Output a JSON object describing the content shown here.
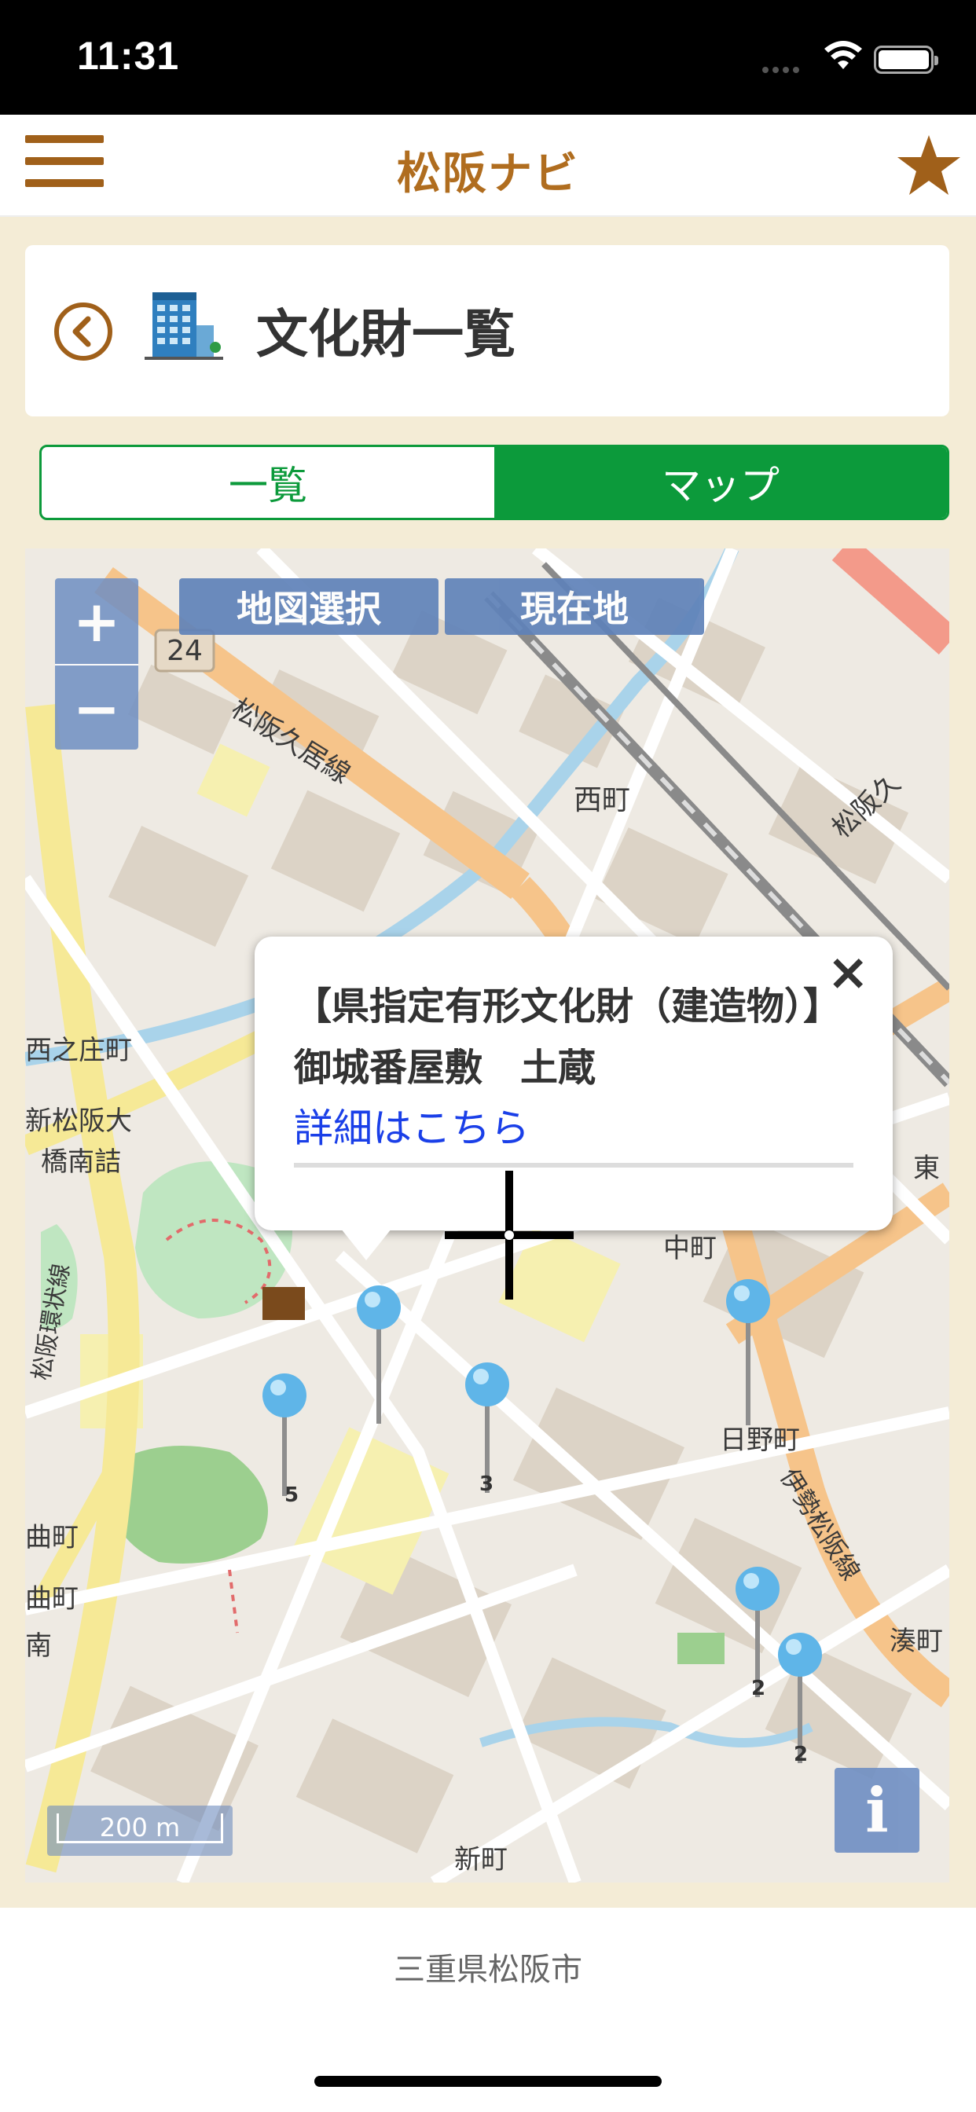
{
  "status_bar": {
    "time": "11:31"
  },
  "nav": {
    "title": "松阪ナビ"
  },
  "header": {
    "title": "文化財一覧"
  },
  "tabs": [
    {
      "label": "一覧",
      "active": false
    },
    {
      "label": "マップ",
      "active": true
    }
  ],
  "map": {
    "buttons": {
      "zoom_in": "+",
      "zoom_out": "−",
      "map_select": "地図選択",
      "current_location": "現在地",
      "info": "i"
    },
    "scale": "200 m",
    "labels": {
      "route": "24",
      "road1": "松阪久居線",
      "road2": "松阪久",
      "nishimachi": "西町",
      "nishinosho": "西之庄町",
      "shinmatsusaka1": "新松阪大",
      "shinmatsusaka2": "橋南詰",
      "nakamachi": "中町",
      "hinomachi": "日野町",
      "ise_road": "伊勢松阪線",
      "minatomachi": "湊町",
      "shinmachi": "新町",
      "higashi": "東",
      "machi1": "曲町",
      "machi2": "曲町",
      "minami": "南",
      "loop": "松阪環状線"
    },
    "pins": [
      {
        "count": "5"
      },
      {
        "count": ""
      },
      {
        "count": "3"
      },
      {
        "count": ""
      },
      {
        "count": "2"
      },
      {
        "count": "2"
      }
    ],
    "popup": {
      "title": "【県指定有形文化財（建造物）】　御城番屋敷　土蔵",
      "link": "詳細はこちら",
      "close": "×"
    }
  },
  "footer": {
    "text": "三重県松阪市"
  },
  "colors": {
    "brand_brown": "#b06d1f",
    "accent_green": "#0c9a3b",
    "map_button_blue": "#6f8fc3"
  }
}
